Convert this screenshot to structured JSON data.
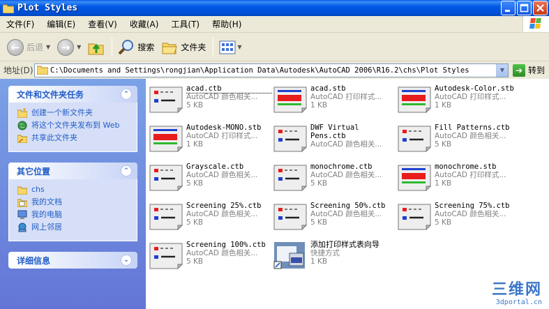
{
  "window": {
    "title": "Plot Styles"
  },
  "menu": [
    "文件(F)",
    "编辑(E)",
    "查看(V)",
    "收藏(A)",
    "工具(T)",
    "帮助(H)"
  ],
  "toolbar": {
    "back": "后退",
    "search": "搜索",
    "folders": "文件夹"
  },
  "address": {
    "label": "地址(D)",
    "path": "C:\\Documents and Settings\\rongjian\\Application Data\\Autodesk\\AutoCAD 2006\\R16.2\\chs\\Plot Styles",
    "go": "转到"
  },
  "panels": {
    "tasks": {
      "title": "文件和文件夹任务",
      "items": [
        "创建一个新文件夹",
        "将这个文件夹发布到 Web",
        "共享此文件夹"
      ]
    },
    "places": {
      "title": "其它位置",
      "items": [
        "chs",
        "我的文档",
        "我的电脑",
        "网上邻居"
      ]
    },
    "details": {
      "title": "详细信息"
    }
  },
  "files": [
    {
      "name": "acad.ctb",
      "type": "AutoCAD 颜色相关...",
      "size": "5 KB",
      "kind": "ctb"
    },
    {
      "name": "acad.stb",
      "type": "AutoCAD 打印样式...",
      "size": "1 KB",
      "kind": "stb"
    },
    {
      "name": "Autodesk-Color.stb",
      "type": "AutoCAD 打印样式...",
      "size": "1 KB",
      "kind": "stb"
    },
    {
      "name": "Autodesk-MONO.stb",
      "type": "AutoCAD 打印样式...",
      "size": "1 KB",
      "kind": "stb"
    },
    {
      "name": "DWF Virtual Pens.ctb",
      "type": "AutoCAD 颜色相关...",
      "size": "",
      "kind": "ctb"
    },
    {
      "name": "Fill Patterns.ctb",
      "type": "AutoCAD 颜色相关...",
      "size": "5 KB",
      "kind": "ctb"
    },
    {
      "name": "Grayscale.ctb",
      "type": "AutoCAD 颜色相关...",
      "size": "5 KB",
      "kind": "ctb"
    },
    {
      "name": "monochrome.ctb",
      "type": "AutoCAD 颜色相关...",
      "size": "5 KB",
      "kind": "ctb"
    },
    {
      "name": "monochrome.stb",
      "type": "AutoCAD 打印样式...",
      "size": "1 KB",
      "kind": "stb"
    },
    {
      "name": "Screening 25%.ctb",
      "type": "AutoCAD 颜色相关...",
      "size": "5 KB",
      "kind": "ctb"
    },
    {
      "name": "Screening 50%.ctb",
      "type": "AutoCAD 颜色相关...",
      "size": "5 KB",
      "kind": "ctb"
    },
    {
      "name": "Screening 75%.ctb",
      "type": "AutoCAD 颜色相关...",
      "size": "5 KB",
      "kind": "ctb"
    },
    {
      "name": "Screening 100%.ctb",
      "type": "AutoCAD 颜色相关...",
      "size": "5 KB",
      "kind": "ctb"
    },
    {
      "name": "添加打印样式表向导",
      "type": "快捷方式",
      "size": "1 KB",
      "kind": "wizard"
    }
  ],
  "watermark": {
    "line1": "三维网",
    "line2": "3dportal.cn"
  }
}
